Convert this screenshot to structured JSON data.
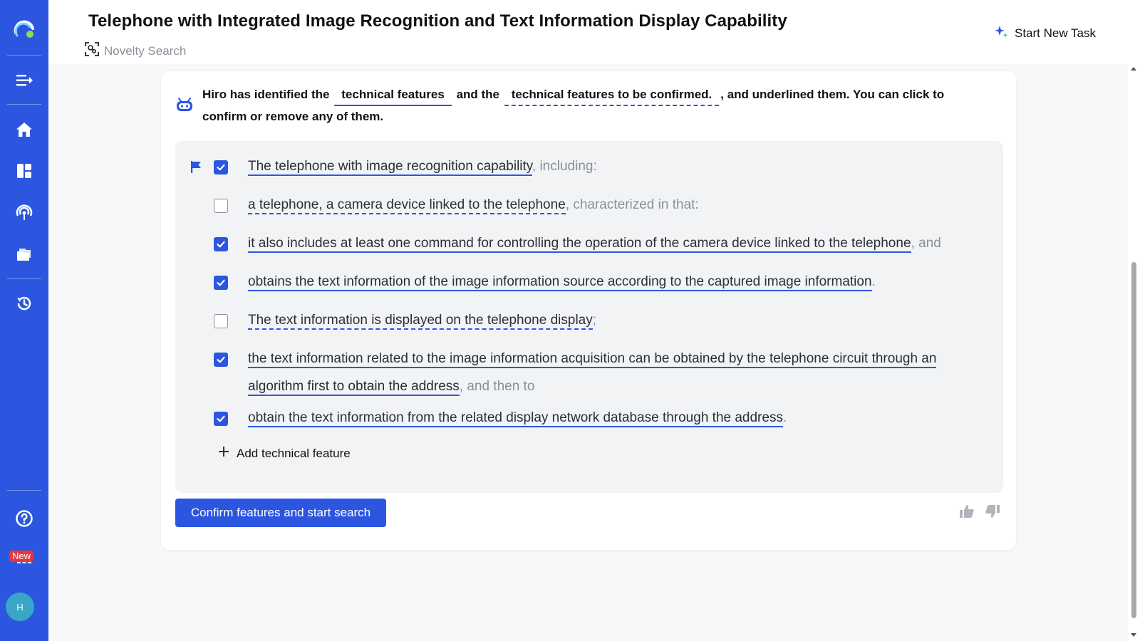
{
  "app": {
    "brand_color": "#2c56e0",
    "avatar_initial": "H",
    "new_badge": "New"
  },
  "sidebar": {
    "items": [
      {
        "icon": "logo-icon"
      },
      {
        "icon": "collapse-menu-icon"
      },
      {
        "icon": "home-icon"
      },
      {
        "icon": "dashboard-icon"
      },
      {
        "icon": "monitor-icon"
      },
      {
        "icon": "folder-icon"
      },
      {
        "icon": "history-icon"
      },
      {
        "icon": "help-icon"
      },
      {
        "icon": "apps-icon"
      }
    ]
  },
  "header": {
    "title": "Telephone with Integrated Image Recognition and Text Information Display Capability",
    "subtitle": "Novelty Search",
    "start_new_task": "Start New Task"
  },
  "intro": {
    "prefix": "Hiro has identified the",
    "tag_solid": "technical features",
    "middle": "and the",
    "tag_dashed": "technical features to be confirmed.",
    "suffix": ", and underlined them. You can click to confirm or remove any of them."
  },
  "features": [
    {
      "checked": true,
      "style": "solid",
      "text": "The telephone with image recognition capability",
      "tail": ", including:"
    },
    {
      "checked": false,
      "style": "dashed",
      "text": "a telephone, a camera device linked to the telephone",
      "tail": ", characterized in that:"
    },
    {
      "checked": true,
      "style": "solid",
      "text": "it also includes at least one command for controlling the operation of the camera device linked to the telephone",
      "tail": ", and"
    },
    {
      "checked": true,
      "style": "solid",
      "text": "obtains the text information of the image information source according to the captured image information",
      "tail": "."
    },
    {
      "checked": false,
      "style": "dashed",
      "text": "The text information is displayed on the telephone display",
      "tail": ";"
    },
    {
      "checked": true,
      "style": "solid",
      "text": "the text information related to the image information acquisition can be obtained by the telephone circuit through an algorithm first to obtain the address",
      "tail": ", and then to"
    },
    {
      "checked": true,
      "style": "solid",
      "text": "obtain the text information from the related display network database through the address",
      "tail": "."
    }
  ],
  "add_feature_label": "Add technical feature",
  "confirm_button": "Confirm features and start search"
}
